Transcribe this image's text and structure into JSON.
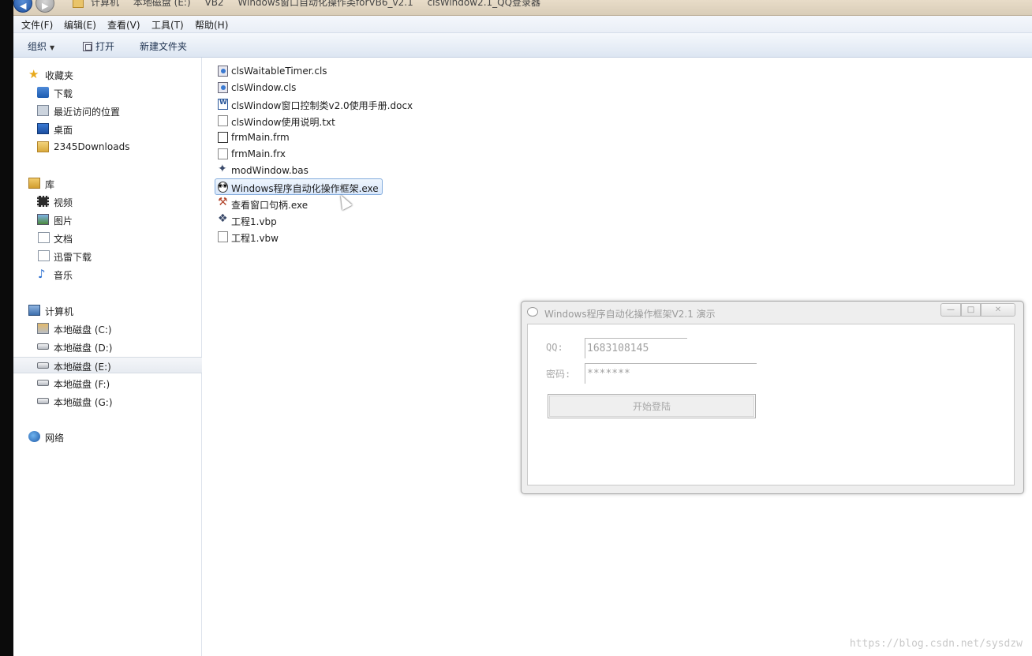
{
  "address_bar": {
    "breadcrumbs": [
      "计算机",
      "本地磁盘 (E:)",
      "VB2",
      "Windows窗口自动化操作类forVB6_v2.1",
      "clsWindow2.1_QQ登录器"
    ]
  },
  "menu": {
    "items": [
      "文件(F)",
      "编辑(E)",
      "查看(V)",
      "工具(T)",
      "帮助(H)"
    ]
  },
  "toolbar": {
    "organize": "组织",
    "open": "打开",
    "new_folder": "新建文件夹"
  },
  "nav": {
    "favorites": "收藏夹",
    "downloads": "下载",
    "recent": "最近访问的位置",
    "desktop": "桌面",
    "downloads_2345": "2345Downloads",
    "libraries": "库",
    "videos": "视频",
    "pictures": "图片",
    "documents": "文档",
    "thunder": "迅雷下载",
    "music": "音乐",
    "computer": "计算机",
    "drive_c": "本地磁盘 (C:)",
    "drive_d": "本地磁盘 (D:)",
    "drive_e": "本地磁盘 (E:)",
    "drive_f": "本地磁盘 (F:)",
    "drive_g": "本地磁盘 (G:)",
    "network": "网络"
  },
  "files": [
    "clsWaitableTimer.cls",
    "clsWindow.cls",
    "clsWindow窗口控制类v2.0使用手册.docx",
    "clsWindow使用说明.txt",
    "frmMain.frm",
    "frmMain.frx",
    "modWindow.bas",
    "Windows程序自动化操作框架.exe",
    "查看窗口句柄.exe",
    "工程1.vbp",
    "工程1.vbw"
  ],
  "dialog": {
    "title": "Windows程序自动化操作框架V2.1 演示",
    "qq_label": "QQ:",
    "qq_value": "1683108145",
    "password_label": "密码:",
    "password_value": "*******",
    "login_button": "开始登陆",
    "close_glyph": "✕",
    "max_glyph": "□",
    "min_glyph": "—"
  },
  "watermark": "https://blog.csdn.net/sysdzw",
  "colors": {
    "selection": "#d8e7fb",
    "selection_border": "#84acdd",
    "toolbar_text": "#1e3250"
  }
}
